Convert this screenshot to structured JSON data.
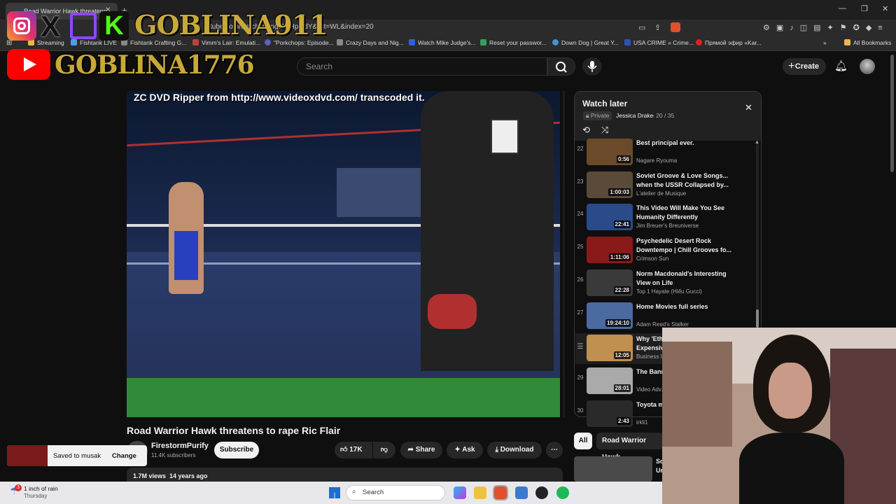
{
  "browser": {
    "tab_title": "Road Warrior Hawk threatens",
    "url": "tube.com/watch?v=ng6kpHpcfdY&list=WL&index=20",
    "bookmarks": [
      {
        "label": "Streaming",
        "color": "#e8b84a"
      },
      {
        "label": "Fishtank LIVE",
        "color": "#4aa0e8"
      },
      {
        "label": "Fishtank Crafting G...",
        "color": "#888888"
      },
      {
        "label": "Vimm's Lair: Emulati...",
        "color": "#c04040"
      },
      {
        "label": "\"Porkchops: Episode...",
        "color": "#6060c0"
      },
      {
        "label": "Crazy Days and Nig...",
        "color": "#888888"
      },
      {
        "label": "Watch Mike Judge's...",
        "color": "#3060e0"
      },
      {
        "label": "Reset your passwor...",
        "color": "#30a060"
      },
      {
        "label": "Down Dog | Great Y...",
        "color": "#4a90d0"
      },
      {
        "label": "USA CRIME » Crime...",
        "color": "#3050c0"
      },
      {
        "label": "Прямой эфир «Kar...",
        "color": "#e02020"
      }
    ],
    "all_bookmarks": "All Bookmarks"
  },
  "overlay": {
    "handle1": "GOBLINA911",
    "handle2": "GOBLINA1776"
  },
  "header": {
    "search_placeholder": "Search",
    "create_label": "Create"
  },
  "video": {
    "overlay_text": "ZC DVD Ripper from http://www.videoxdvd.com/ transcoded it.",
    "title": "Road Warrior Hawk threatens to rape Ric Flair",
    "channel": "FirestormPurify",
    "subscribers": "11.4K subscribers",
    "subscribe_label": "Subscribe",
    "likes": "17K",
    "share_label": "Share",
    "ask_label": "Ask",
    "download_label": "Download",
    "views": "1.7M views",
    "age": "14 years ago"
  },
  "toast": {
    "message": "Saved to musak",
    "action": "Change"
  },
  "playlist": {
    "title": "Watch later",
    "privacy": "Private",
    "owner": "Jessica Drake",
    "position": "- 20 / 35",
    "items": [
      {
        "index": "22",
        "title": "Best principal ever.",
        "channel": "Nagare Ryouma",
        "duration": "0:56",
        "color": "#6a4a2a"
      },
      {
        "index": "23",
        "title": "Soviet Groove & Love Songs... when the USSR Collapsed by...",
        "channel": "L'atelier de Musique",
        "duration": "1:00:03",
        "color": "#5a4a3a"
      },
      {
        "index": "24",
        "title": "This Video Will Make You See Humanity Differently",
        "channel": "Jim Breuer's Breuniverse",
        "duration": "22:41",
        "color": "#2a4a8a"
      },
      {
        "index": "25",
        "title": "Psychedelic Desert Rock Downtempo | Chill Grooves fo...",
        "channel": "Crimson Sun",
        "duration": "1:11:06",
        "color": "#8a1a1a"
      },
      {
        "index": "26",
        "title": "Norm Macdonald's Interesting View on Life",
        "channel": "Top 1 Hayate (Hiếu Gucci)",
        "duration": "22:28",
        "color": "#3a3a3a"
      },
      {
        "index": "27",
        "title": "Home Movies full series",
        "channel": "Adam Reed's Stalker",
        "duration": "19:24:10",
        "color": "#4a6aa0"
      },
      {
        "index": "",
        "title": "Why 'Ethical' Eggs Are So Expensive",
        "channel": "Business I...",
        "duration": "12:05",
        "color": "#c09050"
      },
      {
        "index": "29",
        "title": "The Banned Retired C...",
        "channel": "Video Adv...",
        "duration": "28:01",
        "color": "#aaaaaa"
      },
      {
        "index": "30",
        "title": "Toyota m... vs Porsc...",
        "channel": "irkli1",
        "duration": "2:43",
        "color": "#2a2a2a"
      }
    ]
  },
  "chips": {
    "all": "All",
    "related": "Road Warrior Hawk"
  },
  "related": {
    "title_fragment": "Sc",
    "subtitle_fragment": "Ur"
  },
  "taskbar": {
    "weather_temp": "1 inch of rain",
    "weather_day": "Thursday",
    "weather_badge": "3",
    "search_label": "Search"
  }
}
